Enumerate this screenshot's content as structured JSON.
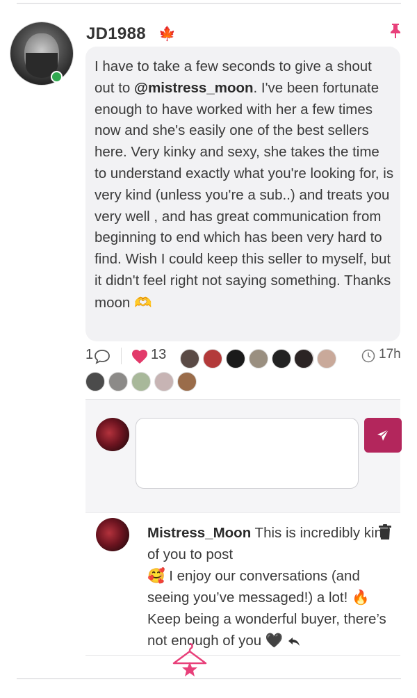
{
  "post": {
    "username": "JD1988",
    "flag_glyph": "🍁",
    "text_before_mention": "I have to take a few seconds to give a shout out to ",
    "mention": "@mistress_moon",
    "text_after_mention": ". I've been fortunate enough to have worked with her a few times now and she's easily one of the best sellers here. Very kinky and sexy, she takes the time to understand exactly what you're looking for, is very kind (unless you're a sub..) and treats you very well , and has great communication from beginning to end which has been very hard to find. Wish I could keep this seller to myself, but it didn't feel right not saying something. Thanks moon",
    "emoji_end": "🫶",
    "comment_count": "1",
    "like_count": "13",
    "time": "17h",
    "avatar_label": "",
    "icon_names": {
      "pin": "pin-icon",
      "comment": "comment-icon",
      "heart": "heart-icon",
      "clock": "clock-icon"
    }
  },
  "likers": {
    "row1_colors": [
      "#5a4a45",
      "#b33a3a",
      "#1a1a1a",
      "#9a8f80",
      "#222222",
      "#c2332f",
      "#2b2424",
      "#c9a99a"
    ],
    "row2_colors": [
      "#4b4b4b",
      "#8c8a88",
      "#a8b89a",
      "#c7b4b4",
      "#9a6c4a"
    ]
  },
  "reply_composer": {
    "placeholder": "",
    "send_icon": "send-icon"
  },
  "reply": {
    "author": "Mistress_Moon",
    "text_part1": " This is incredibly kind of you to post ",
    "emoji1": "🥰",
    "text_part2": " I enjoy our conversations (and seeing you’ve messaged!) a lot! ",
    "emoji2": "🔥",
    "text_part3": " Keep being a wonderful buyer, there’s not enough of you ",
    "emoji3": "🖤",
    "reply_icon": "reply-arrow-icon",
    "trash_icon": "trash-icon"
  },
  "colors": {
    "accent": "#b3265c",
    "pink": "#e8407a",
    "online": "#2fa84f"
  }
}
